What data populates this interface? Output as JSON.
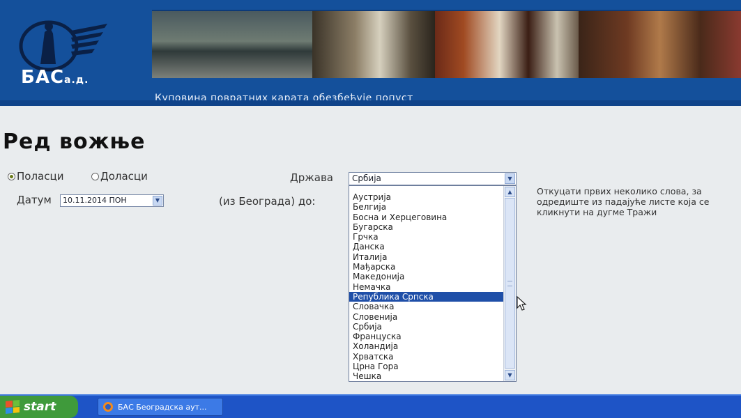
{
  "header": {
    "logo_main": "БАС",
    "logo_suffix": "а.д.",
    "tagline": "Куповина повратних карата обезбеђује попуст"
  },
  "page": {
    "title": "Ред вожње"
  },
  "form": {
    "radio_departures": "Поласци",
    "radio_arrivals": "Доласци",
    "country_label": "Држава",
    "country_value": "Србија",
    "date_label": "Датум",
    "date_value": "10.11.2014 ПОН",
    "destination_label": "(из Београда) до:",
    "instructions": [
      "Откуцати првих неколико слова, за",
      "одредиште из падајуће листе која се",
      "кликнути на дугме Тражи"
    ]
  },
  "country_list": {
    "items": [
      "Аустрија",
      "Белгија",
      "Босна и Херцеговина",
      "Бугарска",
      "Грчка",
      "Данска",
      "Италија",
      "Мађарска",
      "Македонија",
      "Немачка",
      "Република Српска",
      "Словачка",
      "Словенија",
      "Србија",
      "Француска",
      "Холандија",
      "Хрватска",
      "Црна Гора",
      "Чешка"
    ],
    "highlighted": "Република Српска"
  },
  "taskbar": {
    "start_label": "start",
    "task_label": "БАС Београдска аут..."
  },
  "colors": {
    "header_blue": "#14509b",
    "selection_blue": "#1f4fa8",
    "taskbar_blue": "#1e54c6",
    "start_green": "#3f9a3b"
  },
  "icons": [
    "bas-logo",
    "radio-checked",
    "radio-unchecked",
    "dropdown-arrow",
    "scroll-up-arrow",
    "scroll-down-arrow",
    "mouse-cursor",
    "windows-flag",
    "browser-icon"
  ]
}
